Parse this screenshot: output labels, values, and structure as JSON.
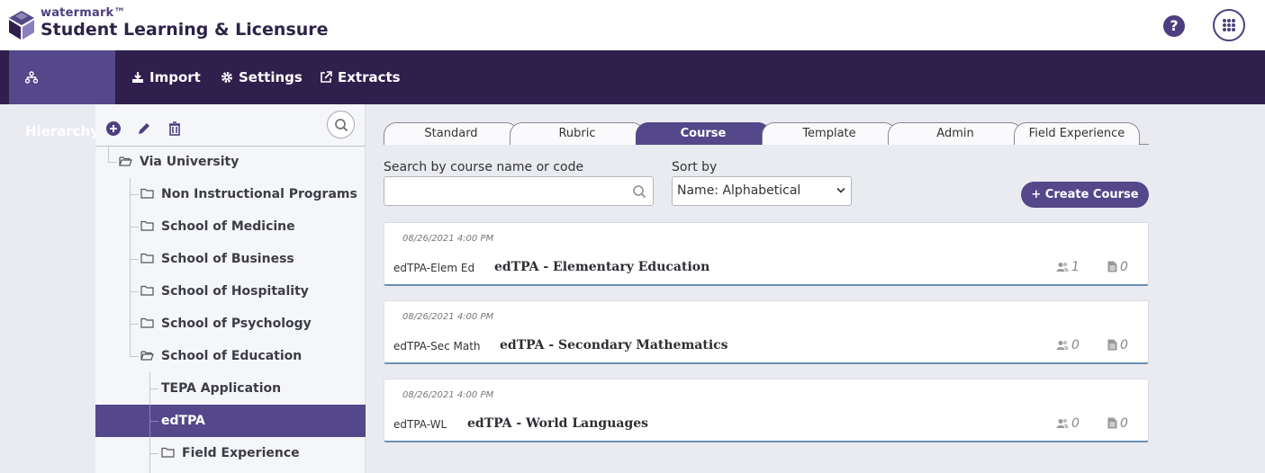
{
  "header": {
    "brand_small": "watermark™",
    "brand_big": "Student Learning & Licensure",
    "help_label": "?"
  },
  "nav": [
    {
      "label": "Hierarchy",
      "active": true
    },
    {
      "label": "Import",
      "active": false
    },
    {
      "label": "Settings",
      "active": false
    },
    {
      "label": "Extracts",
      "active": false
    }
  ],
  "tree": {
    "root": "Via University",
    "items": [
      {
        "label": "Non Instructional Programs"
      },
      {
        "label": "School of Medicine"
      },
      {
        "label": "School of Business"
      },
      {
        "label": "School of Hospitality"
      },
      {
        "label": "School of Psychology"
      },
      {
        "label": "School of Education"
      }
    ],
    "children": [
      {
        "label": "TEPA Application"
      },
      {
        "label": "edTPA"
      },
      {
        "label": "Field Experience"
      }
    ]
  },
  "tabs": [
    {
      "label": "Standard"
    },
    {
      "label": "Rubric"
    },
    {
      "label": "Course"
    },
    {
      "label": "Template"
    },
    {
      "label": "Admin"
    },
    {
      "label": "Field Experience"
    }
  ],
  "search": {
    "label": "Search by course name or code",
    "value": "",
    "placeholder": ""
  },
  "sort": {
    "label": "Sort by",
    "selected": "Name: Alphabetical"
  },
  "create_button": "+ Create Course",
  "courses": [
    {
      "date": "08/26/2021 4:00 PM",
      "code": "edTPA-Elem Ed",
      "name": "edTPA - Elementary Education",
      "users": "1",
      "docs": "0"
    },
    {
      "date": "08/26/2021 4:00 PM",
      "code": "edTPA-Sec Math",
      "name": "edTPA - Secondary Mathematics",
      "users": "0",
      "docs": "0"
    },
    {
      "date": "08/26/2021 4:00 PM",
      "code": "edTPA-WL",
      "name": "edTPA - World Languages",
      "users": "0",
      "docs": "0"
    }
  ],
  "colors": {
    "nav_bg": "#2f1f4c",
    "accent": "#54478a",
    "card_border": "#6b8fb3"
  }
}
